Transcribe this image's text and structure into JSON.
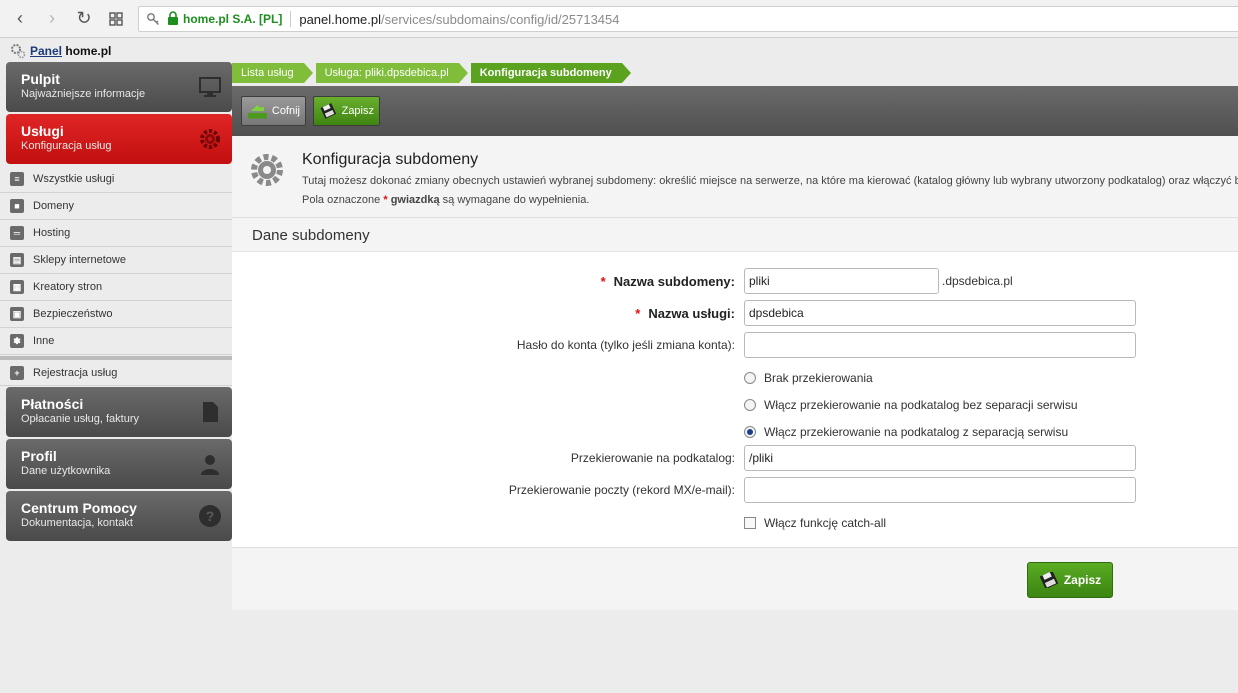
{
  "browser": {
    "secure_label": "home.pl S.A. [PL]",
    "url_host": "panel.home.pl",
    "url_path": "/services/subdomains/config/id/25713454",
    "icons": [
      "back-icon",
      "forward-icon",
      "reload-icon",
      "apps-icon",
      "key-icon",
      "lock-icon"
    ]
  },
  "logo": {
    "word1": "Panel",
    "word2": "home",
    "word3": ".pl"
  },
  "sidebar": {
    "main": [
      {
        "title": "Pulpit",
        "subtitle": "Najważniejsze informacje",
        "icon": "monitor-icon"
      },
      {
        "title": "Usługi",
        "subtitle": "Konfiguracja usług",
        "icon": "gear-icon"
      }
    ],
    "items": [
      {
        "label": "Wszystkie usługi",
        "icon": "clipboard-icon"
      },
      {
        "label": "Domeny",
        "icon": "document-icon"
      },
      {
        "label": "Hosting",
        "icon": "server-icon"
      },
      {
        "label": "Sklepy internetowe",
        "icon": "cart-icon"
      },
      {
        "label": "Kreatory stron",
        "icon": "layout-icon"
      },
      {
        "label": "Bezpieczeństwo",
        "icon": "lock-icon"
      },
      {
        "label": "Inne",
        "icon": "asterisk-icon"
      }
    ],
    "register": {
      "label": "Rejestracja usług",
      "icon": "plus-icon"
    },
    "bottom": [
      {
        "title": "Płatności",
        "subtitle": "Opłacanie usług, faktury",
        "icon": "invoice-icon"
      },
      {
        "title": "Profil",
        "subtitle": "Dane użytkownika",
        "icon": "user-icon"
      },
      {
        "title": "Centrum Pomocy",
        "subtitle": "Dokumentacja, kontakt",
        "icon": "help-icon"
      }
    ]
  },
  "breadcrumb": [
    "Lista usług",
    "Usługa: pliki.dpsdebica.pl",
    "Konfiguracja subdomeny"
  ],
  "toolbar": {
    "back_label": "Cofnij",
    "save_label": "Zapisz"
  },
  "page": {
    "title": "Konfiguracja subdomeny",
    "description": "Tutaj możesz dokonać zmiany obecnych ustawień wybranej subdomeny: określić miejsce na serwerze, na które ma kierować (katalog główny lub wybrany utworzony podkatalog) oraz włączyć b",
    "required_pre": "Pola oznaczone",
    "required_star": "*",
    "required_word": "gwiazdką",
    "required_post": "są wymagane do wypełnienia."
  },
  "section_title": "Dane subdomeny",
  "form": {
    "subdomain_label": "Nazwa subdomeny:",
    "subdomain_value": "pliki",
    "subdomain_suffix": ".dpsdebica.pl",
    "service_label": "Nazwa usługi:",
    "service_value": "dpsdebica",
    "password_label": "Hasło do konta (tylko jeśli zmiana konta):",
    "password_value": "",
    "radio_options": [
      {
        "label": "Brak przekierowania",
        "checked": false
      },
      {
        "label": "Włącz przekierowanie na podkatalog bez separacji serwisu",
        "checked": false
      },
      {
        "label": "Włącz przekierowanie na podkatalog z separacją serwisu",
        "checked": true
      }
    ],
    "redirect_label": "Przekierowanie na podkatalog:",
    "redirect_value": "/pliki",
    "mail_label": "Przekierowanie poczty (rekord MX/e-mail):",
    "mail_value": "",
    "catchall_label": "Włącz funkcję catch-all",
    "catchall_checked": false,
    "required_mark": "*"
  },
  "footer": {
    "save_label": "Zapisz"
  },
  "colors": {
    "accent_red": "#c20f0f",
    "accent_green": "#5ba31f",
    "dark_grey": "#505050"
  }
}
